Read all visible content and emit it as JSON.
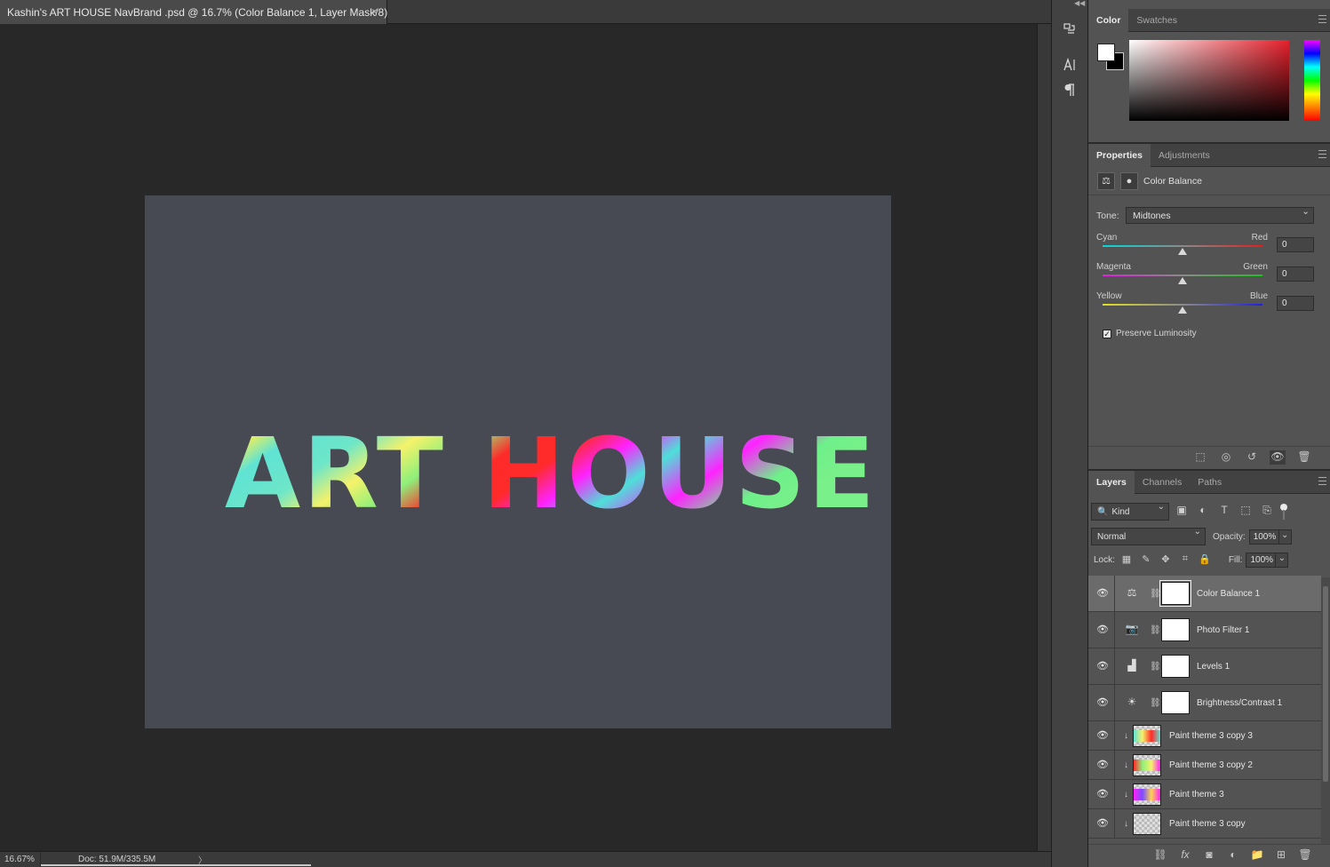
{
  "document": {
    "tab_title": "Kashin's ART HOUSE NavBrand .psd @ 16.7% (Color Balance 1, Layer Mask/8)",
    "close_glyph": "×",
    "artwork_text": "ART HOUSE",
    "canvas_color": "#474a52"
  },
  "status": {
    "zoom": "16.67%",
    "doc_size": "Doc: 51.9M/335.5M",
    "arrow": "〉"
  },
  "tool_strip": {
    "items": [
      {
        "icon": "history-brush-icon",
        "glyph": "⎌"
      },
      {
        "icon": "character-icon",
        "glyph": "A|"
      },
      {
        "icon": "paragraph-icon",
        "glyph": "¶"
      }
    ]
  },
  "color_panel": {
    "tabs": [
      {
        "label": "Color"
      },
      {
        "label": "Swatches"
      }
    ],
    "foreground": "#ffffff",
    "background": "#000000"
  },
  "properties_panel": {
    "tabs": [
      {
        "label": "Properties"
      },
      {
        "label": "Adjustments"
      }
    ],
    "title": "Color Balance",
    "tone_label": "Tone:",
    "tone_value": "Midtones",
    "sliders": [
      {
        "left": "Cyan",
        "right": "Red",
        "value": "0",
        "level": 0
      },
      {
        "left": "Magenta",
        "right": "Green",
        "value": "0",
        "level": 0
      },
      {
        "left": "Yellow",
        "right": "Blue",
        "value": "0",
        "level": 0
      }
    ],
    "preserve_label": "Preserve Luminosity",
    "preserve_checked": true
  },
  "layers_panel": {
    "tabs": [
      {
        "label": "Layers"
      },
      {
        "label": "Channels"
      },
      {
        "label": "Paths"
      }
    ],
    "filter_kind": "Kind",
    "blend_mode": "Normal",
    "opacity_label": "Opacity:",
    "opacity_value": "100%",
    "lock_label": "Lock:",
    "fill_label": "Fill:",
    "fill_value": "100%",
    "adjustment_layers": [
      {
        "name": "Color Balance 1",
        "icon": "color-balance-icon",
        "glyph": "⚖",
        "selected": true
      },
      {
        "name": "Photo Filter 1",
        "icon": "photo-filter-icon",
        "glyph": "📷",
        "selected": false
      },
      {
        "name": "Levels 1",
        "icon": "levels-icon",
        "glyph": "▟",
        "selected": false
      },
      {
        "name": "Brightness/Contrast 1",
        "icon": "brightness-contrast-icon",
        "glyph": "☀",
        "selected": false
      }
    ],
    "pixel_layers": [
      {
        "name": "Paint theme 3 copy 3"
      },
      {
        "name": "Paint theme 3 copy 2"
      },
      {
        "name": "Paint theme 3"
      },
      {
        "name": "Paint theme 3 copy"
      }
    ]
  }
}
